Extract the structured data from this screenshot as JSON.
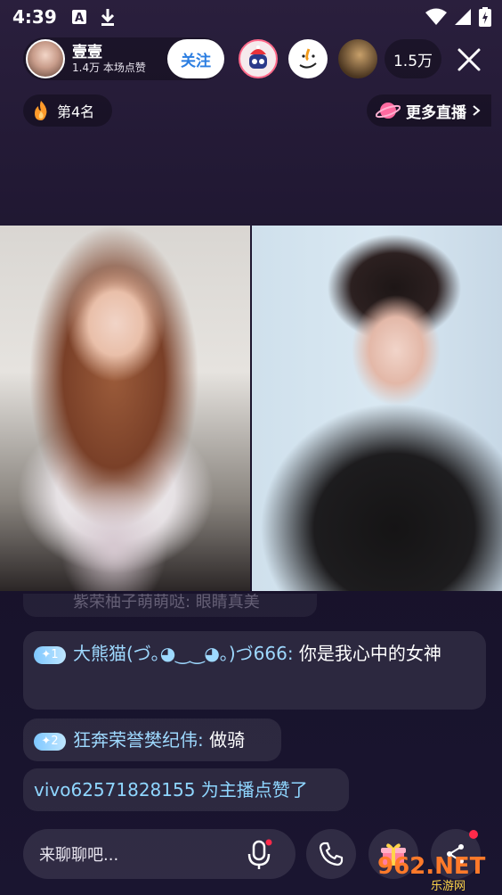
{
  "status_bar": {
    "time": "4:39"
  },
  "host": {
    "name": "壹壹",
    "likes": "1.4万 本场点赞",
    "follow_label": "关注"
  },
  "viewers": {
    "count": "1.5万"
  },
  "rank": {
    "label": "第4名"
  },
  "more_live": {
    "label": "更多直播"
  },
  "chat": {
    "faded_text": "紫荣柚子萌萌哒: 眼睛真美",
    "messages": [
      {
        "badge": "1",
        "user": "大熊猫(づ｡◕‿‿◕｡)づ666:",
        "text": " 你是我心中的女神"
      },
      {
        "badge": "2",
        "user": "狂奔荣誉樊纪伟:",
        "text": " 做骑"
      },
      {
        "system": "vivo62571828155 为主播点赞了"
      }
    ]
  },
  "input": {
    "placeholder": "来聊聊吧..."
  },
  "watermark": {
    "logo": "962.NET",
    "sub": "乐游网"
  },
  "colors": {
    "follow_text": "#2a7de1",
    "accent_red": "#ff2a4a",
    "username": "#9ed9ff"
  }
}
